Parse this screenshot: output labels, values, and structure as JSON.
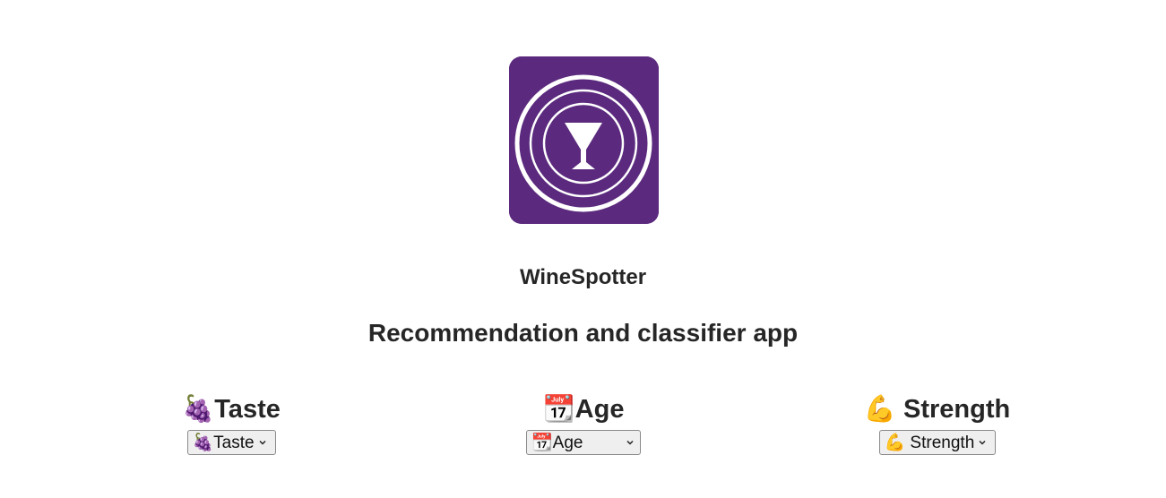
{
  "app": {
    "name": "WineSpotter",
    "subtitle": "Recommendation and classifier app",
    "brand_color": "#5b2a7e",
    "logo_icon": "wine-glass-icon"
  },
  "filters": [
    {
      "label": "🍇Taste",
      "select_value": "🍇Taste"
    },
    {
      "label": "📆Age",
      "select_value": "📆Age"
    },
    {
      "label": "💪 Strength",
      "select_value": "💪 Strength"
    }
  ]
}
